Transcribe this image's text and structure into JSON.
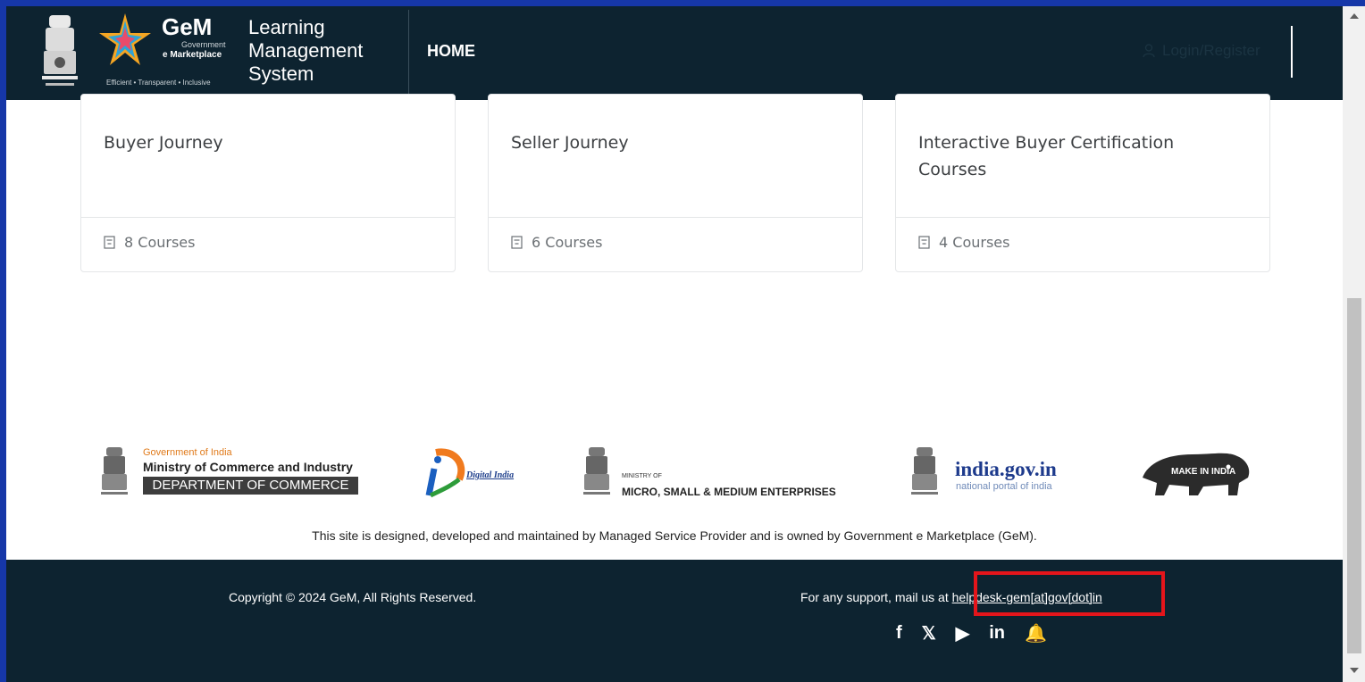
{
  "header": {
    "gem_title": "GeM",
    "gem_sub1": "Government",
    "gem_sub2": "e Marketplace",
    "gem_tagline": "Efficient • Transparent • Inclusive",
    "lms_line1": "Learning",
    "lms_line2": "Management",
    "lms_line3": "System",
    "nav_home": "HOME",
    "login_label": "Login/Register"
  },
  "cards": [
    {
      "title": "Buyer Journey",
      "courses": "8 Courses"
    },
    {
      "title": "Seller Journey",
      "courses": "6 Courses"
    },
    {
      "title": "Interactive Buyer Certification Courses",
      "courses": "4 Courses"
    }
  ],
  "partners": {
    "commerce_line1": "Government of India",
    "commerce_line2": "Ministry of Commerce and Industry",
    "commerce_line3": "DEPARTMENT OF COMMERCE",
    "digital_india": "Digital India",
    "msme_line1": "MINISTRY OF",
    "msme_line2": "MICRO, SMALL & MEDIUM ENTERPRISES",
    "indiagov_line1": "india.gov.in",
    "indiagov_line2": "national portal of india",
    "make_in_india": "MAKE IN INDIA"
  },
  "disclaimer": "This site is designed, developed and maintained by Managed Service Provider and is owned by Government e Marketplace (GeM).",
  "footer": {
    "copyright": "Copyright © 2024 GeM, All Rights Reserved.",
    "support_prefix": "For any support, mail us at ",
    "support_email": "helpdesk-gem[at]gov[dot]in",
    "social": [
      "f",
      "𝕏",
      "▶",
      "in",
      "🔔"
    ]
  },
  "colors": {
    "header_bg": "#0d2330",
    "highlight": "#e4151b",
    "desktop_bg": "#1637a8"
  }
}
